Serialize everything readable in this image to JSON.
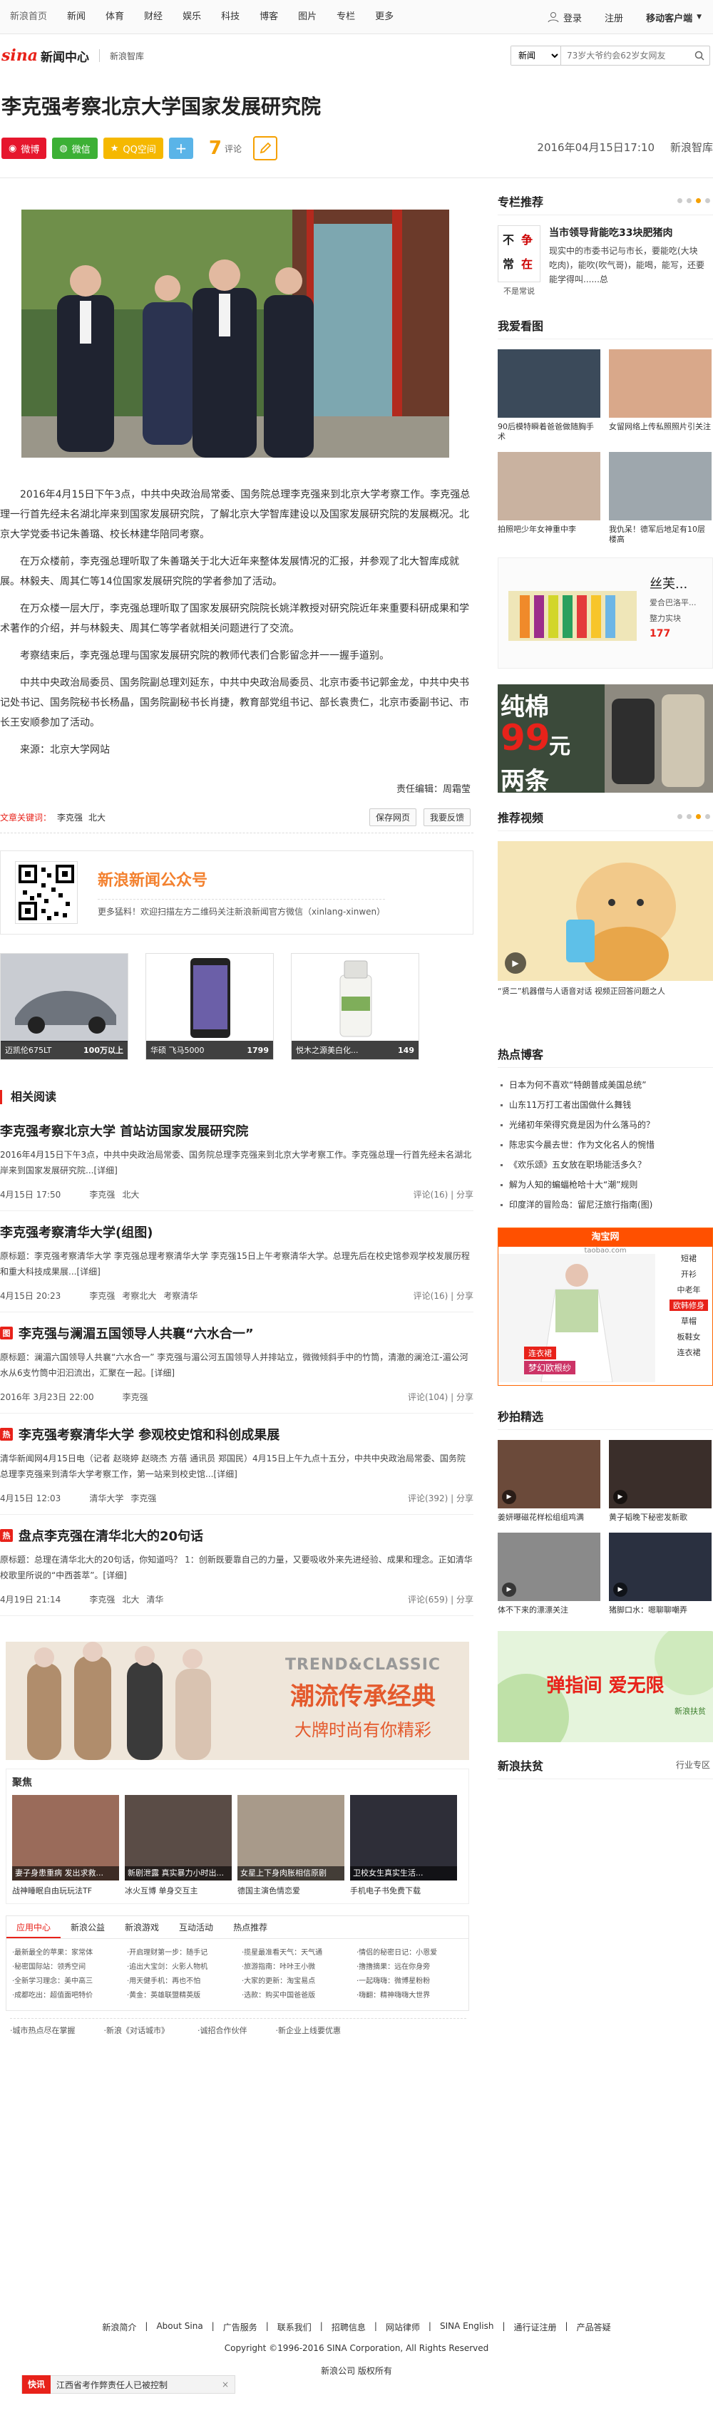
{
  "topnav": {
    "items": [
      "新浪首页",
      "新闻",
      "体育",
      "财经",
      "娱乐",
      "科技",
      "博客",
      "图片",
      "专栏",
      "更多"
    ],
    "login": "登录",
    "register": "注册",
    "mobile": "移动客户端"
  },
  "header": {
    "logo_text": "sina",
    "channel": "新闻中心",
    "subchannel": "新浪智库",
    "search_select": "新闻",
    "search_placeholder": "73岁大爷约会62岁女网友"
  },
  "article": {
    "title": "李克强考察北京大学国家发展研究院",
    "share": {
      "weibo": "微博",
      "weixin": "微信",
      "qq": "QQ空间",
      "plus": "+"
    },
    "comment_count": "7",
    "comment_label": "评论",
    "datetime": "2016年04月15日17:10",
    "source": "新浪智库",
    "paragraphs": [
      "2016年4月15日下午3点，中共中央政治局常委、国务院总理李克强来到北京大学考察工作。李克强总理一行首先经未名湖北岸来到国家发展研究院，了解北京大学智库建设以及国家发展研究院的发展概况。北京大学党委书记朱善璐、校长林建华陪同考察。",
      "在万众楼前，李克强总理听取了朱善璐关于北大近年来整体发展情况的汇报，并参观了北大智库成就展。林毅夫、周其仁等14位国家发展研究院的学者参加了活动。",
      "在万众楼一层大厅，李克强总理听取了国家发展研究院院长姚洋教授对研究院近年来重要科研成果和学术著作的介绍，并与林毅夫、周其仁等学者就相关问题进行了交流。",
      "考察结束后，李克强总理与国家发展研究院的教师代表们合影留念并一一握手道别。",
      "中共中央政治局委员、国务院副总理刘延东，中共中央政治局委员、北京市委书记郭金龙，中共中央书记处书记、国务院秘书长杨晶，国务院副秘书长肖捷，教育部党组书记、部长袁贵仁，北京市委副书记、市长王安顺参加了活动。",
      "来源：北京大学网站"
    ],
    "editor": "责任编辑：周霜莹",
    "keywords_label": "文章关键词：",
    "keywords": [
      "李克强",
      "北大"
    ],
    "save_btn": "保存网页",
    "feedback_btn": "我要反馈"
  },
  "wechat": {
    "title": "新浪新闻公众号",
    "desc": "更多猛料！欢迎扫描左方二维码关注新浪新闻官方微信（xinlang-xinwen）"
  },
  "ads": [
    {
      "name": "迈凯伦675LT",
      "price": "100万以上"
    },
    {
      "name": "华硕 飞马5000",
      "price": "1799"
    },
    {
      "name": "悦木之源美白化...",
      "price": "149"
    }
  ],
  "related": {
    "title": "相关阅读",
    "items": [
      {
        "title": "李克强考察北京大学 首站访国家发展研究院",
        "tag": "",
        "summary": "2016年4月15日下午3点，中共中央政治局常委、国务院总理李克强来到北京大学考察工作。李克强总理一行首先经未名湖北岸来到国家发展研究院...[详细]",
        "date": "4月15日 17:50",
        "tags": [
          "李克强",
          "北大"
        ],
        "comments": "评论(16)"
      },
      {
        "title": "李克强考察清华大学(组图)",
        "tag": "",
        "summary": "原标题：李克强考察清华大学 李克强总理考察清华大学 李克强15日上午考察清华大学。总理先后在校史馆参观学校发展历程和重大科技成果展...[详细]",
        "date": "4月15日 20:23",
        "tags": [
          "李克强",
          "考察北大",
          "考察清华"
        ],
        "comments": "评论(16)"
      },
      {
        "title": "李克强与澜湄五国领导人共襄“六水合一”",
        "tag": "图",
        "summary": "原标题：澜湄六国领导人共襄“六水合一” 李克强与湄公河五国领导人并排站立，微微倾斜手中的竹筒，清澈的澜沧江-湄公河水从6支竹筒中汩汩流出，汇聚在一起。[详细]",
        "date": "2016年 3月23日 22:00",
        "tags": [
          "李克强"
        ],
        "comments": "评论(104)"
      },
      {
        "title": "李克强考察清华大学 参观校史馆和科创成果展",
        "tag": "热",
        "summary": "清华新闻网4月15日电（记者 赵晓婷 赵晓杰 方蓓 通讯员 郑国民）4月15日上午九点十五分，中共中央政治局常委、国务院总理李克强来到清华大学考察工作，第一站来到校史馆...[详细]",
        "date": "4月15日 12:03",
        "tags": [
          "清华大学",
          "李克强"
        ],
        "comments": "评论(392)"
      },
      {
        "title": "盘点李克强在清华北大的20句话",
        "tag": "热",
        "summary": "原标题：总理在清华北大的20句话，你知道吗？ 1：创新既要靠自己的力量，又要吸收外来先进经验、成果和理念。正如清华校歌里所说的“中西荟萃”。[详细]",
        "date": "4月19日 21:14",
        "tags": [
          "李克强",
          "北大",
          "清华"
        ],
        "comments": "评论(659)"
      }
    ],
    "share": "分享"
  },
  "banner": {
    "en": "TREND&CLASSIC",
    "cn1": "潮流传承经典",
    "cn2": "大牌时尚有你精彩"
  },
  "focus": {
    "title": "聚焦",
    "pics": [
      "妻子身患重病 发出求救...",
      "新剧泄露 真实暴力小时出...",
      "女星上下身肉胀相信原剧",
      "卫校女生真实生活..."
    ],
    "captions": [
      "战神睡眠自由玩玩法TF",
      "冰火互博 单身交互主",
      "德国主演色情恋爱",
      "手机电子书免费下载"
    ]
  },
  "links": {
    "tabs": [
      "应用中心",
      "新浪公益",
      "新浪游戏",
      "互动活动",
      "热点推荐"
    ],
    "cols": [
      [
        "·最新最全的苹果：家常体",
        "·秘密国际站：领秀空间",
        "·全新学习理念：美中高三",
        "·成都吃出：超值面吧特价"
      ],
      [
        "·开启理财第一步：随手记",
        "·追出大宝剑：火影人物机",
        "·用天健手机：再也不怕",
        "·黄金：英雄联盟精英版"
      ],
      [
        "·揽星最准看天气：天气通",
        "·旅游指南：咔咔王小微",
        "·大家的更新：淘宝易点",
        "·选款：购买中国爸爸版"
      ],
      [
        "·情侣的秘密日记：小恩爱",
        "·撸撸摘果：远在你身旁",
        "·一起嗨嗨：微博星粉粉",
        "·嗨翻：精神嗨嗨大世界"
      ]
    ]
  },
  "bottom_links": [
    "·城市热点尽在掌握",
    "·新浪《对话城市》",
    "·诚招合作伙伴",
    "·新企业上线要优惠"
  ],
  "footer": {
    "links": [
      "新浪简介",
      "About Sina",
      "广告服务",
      "联系我们",
      "招聘信息",
      "网站律师",
      "SINA English",
      "通行证注册",
      "产品答疑"
    ],
    "copyright": "Copyright ©1996-2016 SINA Corporation, All Rights Reserved",
    "rights": "新浪公司 版权所有"
  },
  "kuaixun": {
    "tag": "快讯",
    "text": "江西省考作弊责任人已被控制",
    "close": "×"
  },
  "sidebar": {
    "tuijian": {
      "title": "专栏推荐",
      "book": [
        "不",
        "争",
        "常",
        "在"
      ],
      "book_caption": "不是常说",
      "item_title": "当市领导背能吃33块肥猪肉",
      "item_desc": "现实中的市委书记与市长，要能吃(大块吃肉)，能吹(吹气哥)，能喝，能写，还要能学得叫......总"
    },
    "kantu": {
      "title": "我爱看图",
      "items": [
        "90后模特瞬着爸爸做随胸手术",
        "女留网络上传私照照片引关注",
        "拍照吧少年女神重中李",
        "我仇呆！德军后地足有10层楼高"
      ]
    },
    "sad": {
      "name": "丝芙...",
      "line1": "爱合巴洛平...",
      "line2": "整力实块",
      "price": "177"
    },
    "mian": {
      "a": "纯棉",
      "b": "99",
      "c": "元",
      "d": "两条"
    },
    "video": {
      "title": "推荐视频",
      "caption": "“贤二”机器僧与人语音对话 视频正回答问题之人"
    },
    "hot": {
      "title": "热点博客",
      "items": [
        "日本为何不喜欢“特朗普成美国总统”",
        "山东11万打工者出国做什么舞钱",
        "光绪初年荣得究竟是因为什么落马的？",
        "陈忠实今晨去世：作为文化名人的惋惜",
        "《欢乐颂》五女放在职场能活多久？",
        "解为人知的蝙蝠枪哈十大“潮”规则",
        "印度洋的冒险岛：留尼汪旅行指南(图)"
      ]
    },
    "taobao": {
      "title": "淘宝网",
      "sub": "taobao.com",
      "cats": [
        "短裙",
        "开衫",
        "中老年",
        "欧韩修身",
        "草帽",
        "板鞋女",
        "连衣裙"
      ],
      "label": "连衣裙",
      "label2": "梦幻欧根纱"
    },
    "miao": {
      "title": "秒拍精选",
      "items": [
        "姜妍曝磁花样松组组鸡满",
        "黄子韬晚下秘密发新歌",
        "体不下来的漂漂关注",
        "猪脚口水：嗯聊聊嘲弄"
      ]
    },
    "gad": {
      "t1": "弹指间 爱无限",
      "t2": "新浪扶贫"
    },
    "fupin": {
      "title": "新浪扶贫",
      "more": "行业专区"
    }
  }
}
